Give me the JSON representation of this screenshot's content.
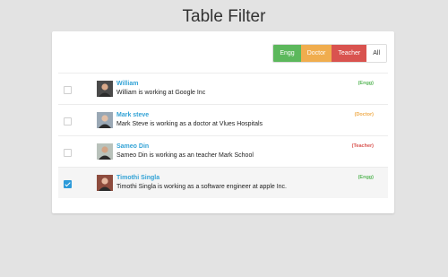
{
  "page": {
    "title": "Table Filter"
  },
  "filters": [
    {
      "label": "Engg",
      "color": "#5cb85c"
    },
    {
      "label": "Doctor",
      "color": "#f0ad4e"
    },
    {
      "label": "Teacher",
      "color": "#d9534f"
    },
    {
      "label": "All",
      "color": "#ffffff"
    }
  ],
  "rows": [
    {
      "name": "William",
      "description": "William is working at Google Inc",
      "tag": "(Engg)",
      "tag_color": "#5cb85c",
      "checked": false,
      "avatar_bg": "#4a4a4a",
      "avatar_skin": "#d9a98a"
    },
    {
      "name": "Mark steve",
      "description": "Mark Steve is working as a doctor at Vlues Hospitals",
      "tag": "(Doctor)",
      "tag_color": "#f0ad4e",
      "checked": false,
      "avatar_bg": "#9aa8b5",
      "avatar_skin": "#e2bfa6"
    },
    {
      "name": "Sameo Din",
      "description": "Sameo Din is working as an teacher Mark School",
      "tag": "(Teacher)",
      "tag_color": "#d9534f",
      "checked": false,
      "avatar_bg": "#b9c2bb",
      "avatar_skin": "#d2a486"
    },
    {
      "name": "Timothi Singla",
      "description": "Timothi Singla is working as a software engineer at apple Inc.",
      "tag": "(Engg)",
      "tag_color": "#5cb85c",
      "checked": true,
      "avatar_bg": "#8e4c3e",
      "avatar_skin": "#e6b8a0"
    }
  ]
}
